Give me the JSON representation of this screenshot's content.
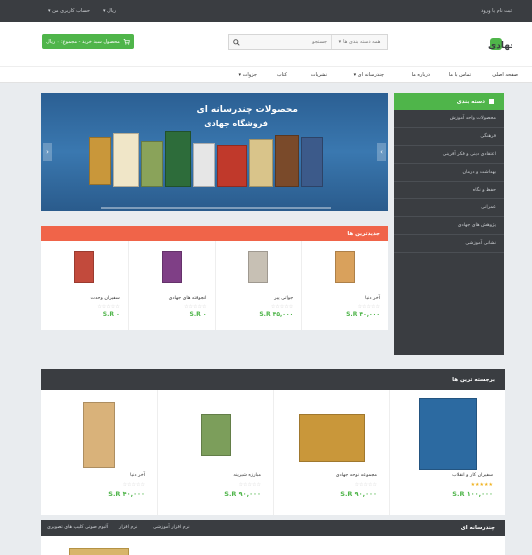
{
  "topbar": {
    "welcome": "ثبت نام یا ورود",
    "currency": "ریال ▾",
    "account": "حساب کاربری من ▾"
  },
  "header": {
    "logo_text": "فروشگاه جهادی",
    "search_placeholder": "جستجو",
    "search_category": "همه دسته بندی ها",
    "cart_label": "محصول سبد خرید - مجموع: ۰ ریال"
  },
  "nav": {
    "items": [
      "صفحه اصلی",
      "تماس با ما",
      "درباره ما",
      "چندرسانه ای ▾",
      "نشریات",
      "کتاب",
      "جزوات ▾"
    ]
  },
  "slider": {
    "title": "محصولات چندرسانه ای",
    "subtitle": "فروشگاه جهادی",
    "prev": "‹",
    "next": "›"
  },
  "sidebar": {
    "title": "دسته بندی",
    "items": [
      "محصولات واحد آموزش",
      "فرهنگی",
      "اعتقادی دینی و فکر آفرینی",
      "بهداشت و درمان",
      "حفظ و نگاه",
      "عمرانی",
      "پژوهش های جهادی",
      "نشانی آموزشی"
    ]
  },
  "new_products": {
    "title": "جدیدترین ها",
    "items": [
      {
        "name": "آخر دنیا",
        "price": "S.R ۴۰,۰۰۰",
        "stars": "☆☆☆☆☆",
        "color": "#d9a15c"
      },
      {
        "name": "جواتی پیر",
        "price": "S.R ۴۵,۰۰۰",
        "stars": "☆☆☆☆☆",
        "color": "#c7c0b4"
      },
      {
        "name": "انجوفته های جهادی",
        "price": "S.R ۰",
        "stars": "☆☆☆☆☆",
        "color": "#7f3f86"
      },
      {
        "name": "سفیران وحدت",
        "price": "S.R ۰",
        "stars": "☆☆☆☆☆",
        "color": "#c24a3c"
      }
    ]
  },
  "featured": {
    "title": "برجسته ترین ها",
    "items": [
      {
        "name": "سفیران کار و انقلاب",
        "price": "S.R ۱۰۰,۰۰۰",
        "stars": "★★★★★",
        "rated": true,
        "color": "#2c6aa1"
      },
      {
        "name": "مجموعه نوحه جهادی",
        "price": "S.R ۹۰,۰۰۰",
        "stars": "☆☆☆☆☆",
        "rated": false,
        "color": "#c9973a"
      },
      {
        "name": "مبارزه شیرینه",
        "price": "S.R ۹۰,۰۰۰",
        "stars": "☆☆☆☆☆",
        "rated": false,
        "color": "#7c9e5b"
      },
      {
        "name": "آخر دنیا",
        "price": "S.R ۴۰,۰۰۰",
        "stars": "☆☆☆☆☆",
        "rated": false,
        "color": "#d9b27a"
      }
    ]
  },
  "multimedia": {
    "title": "چندرسانه ای",
    "tabs": [
      "نرم افزار آموزشی",
      "نرم افزار",
      "آلبوم صوتی",
      "کلیپ های تصویری"
    ]
  }
}
